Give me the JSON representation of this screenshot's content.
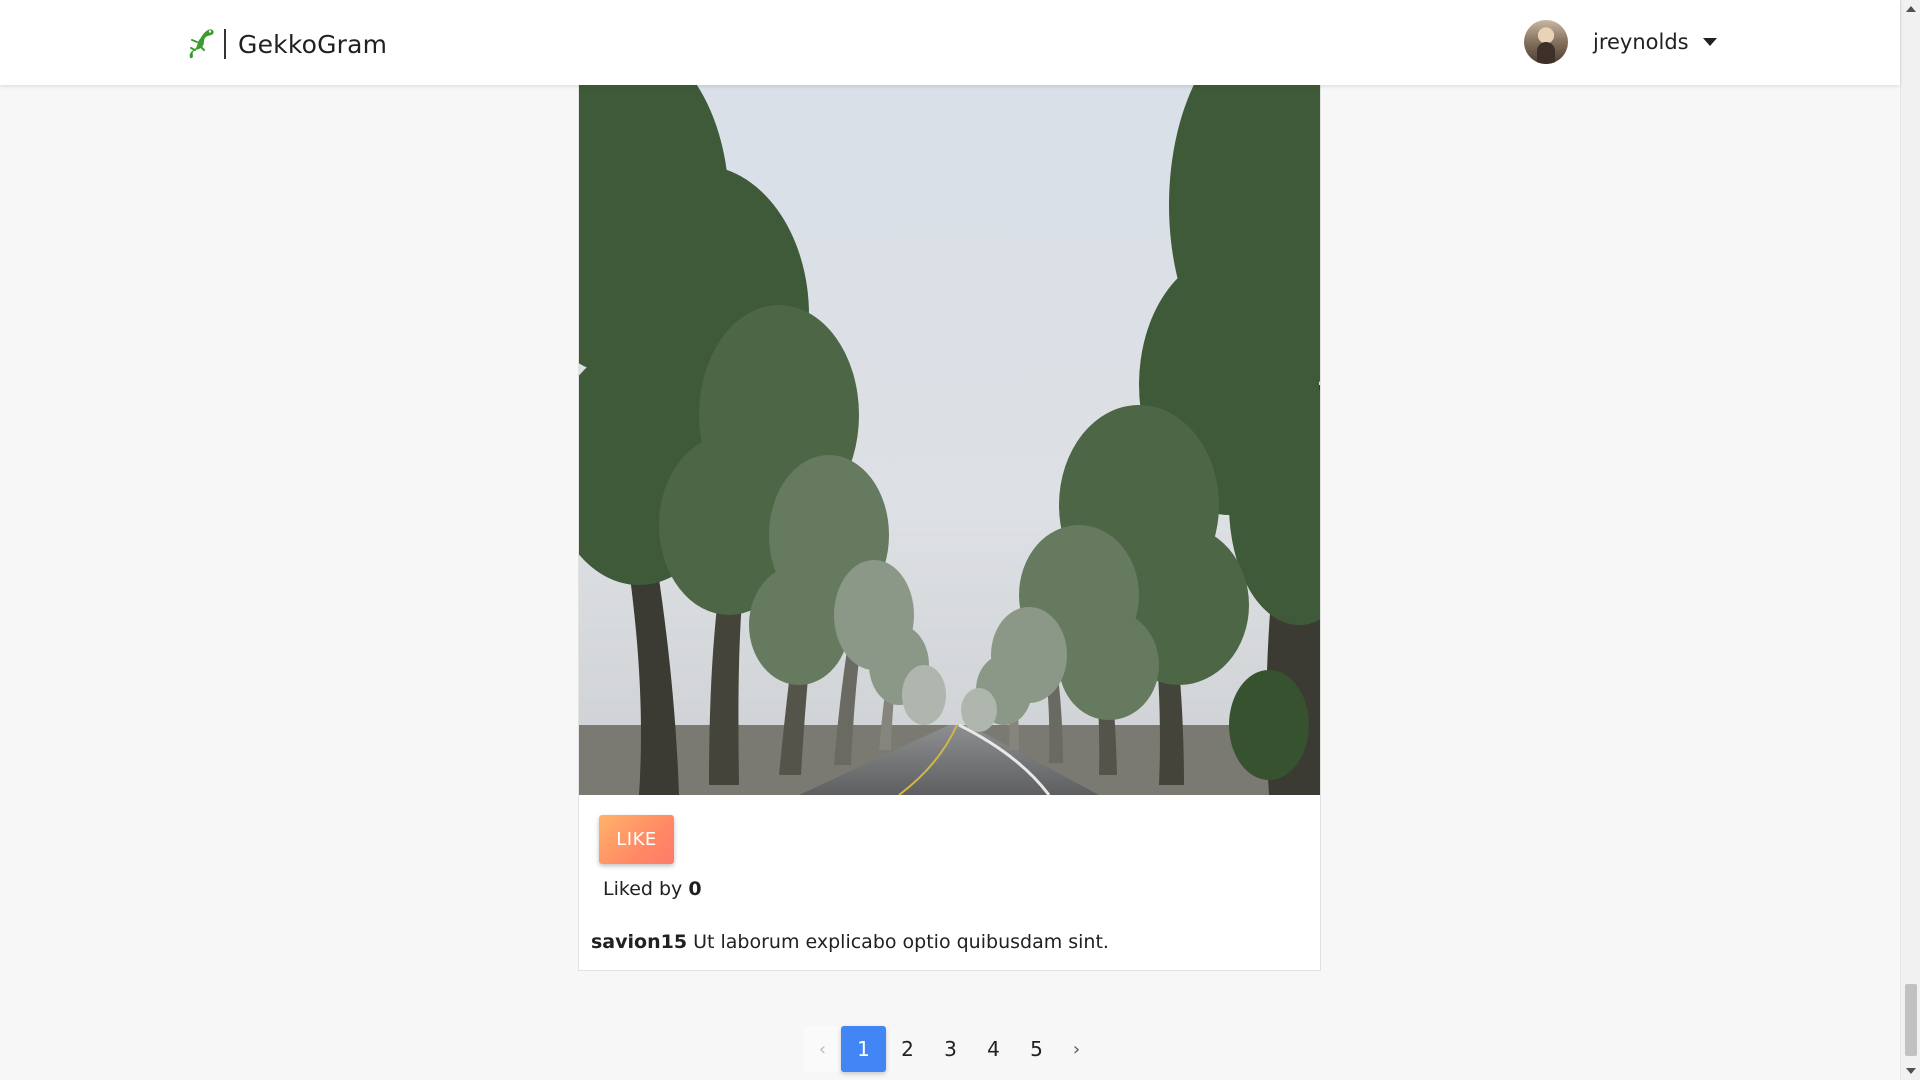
{
  "header": {
    "brand_name": "GekkoGram",
    "logo_icon": "gecko-icon",
    "username": "jreynolds",
    "avatar_icon": "user-avatar",
    "menu_icon": "caret-down-icon"
  },
  "post": {
    "image_alt": "Foggy tree-lined road",
    "like_label": "LIKE",
    "liked_by_label": "Liked by",
    "likes_count": "0",
    "author": "savion15",
    "caption": "Ut laborum explicabo optio quibusdam sint."
  },
  "pagination": {
    "prev": "‹",
    "pages": [
      "1",
      "2",
      "3",
      "4",
      "5"
    ],
    "active_page": "1",
    "next": "›"
  },
  "colors": {
    "accent": "#4285f4",
    "like_gradient_start": "#ffb36b",
    "like_gradient_end": "#ff7b6b",
    "brand_green": "#3a9b2f"
  }
}
